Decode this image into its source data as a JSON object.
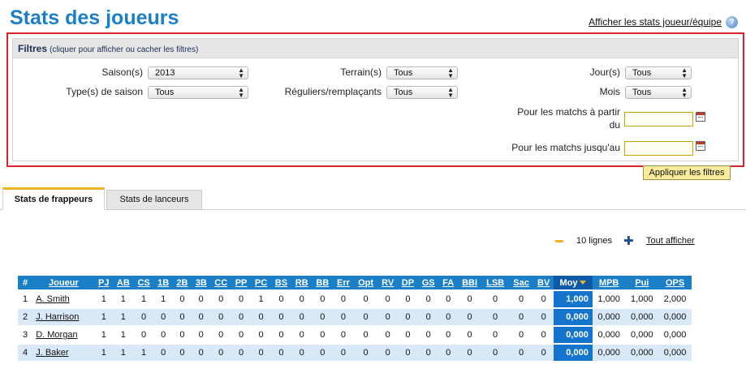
{
  "title": "Stats des joueurs",
  "top_link": "Afficher les stats joueur/équipe",
  "filters": {
    "header_title": "Filtres",
    "header_hint": "(cliquer pour afficher ou cacher les filtres)",
    "season_label": "Saison(s)",
    "season_value": "2013",
    "season_type_label": "Type(s) de saison",
    "season_type_value": "Tous",
    "field_label": "Terrain(s)",
    "field_value": "Tous",
    "regulars_label": "Réguliers/remplaçants",
    "regulars_value": "Tous",
    "day_label": "Jour(s)",
    "day_value": "Tous",
    "month_label": "Mois",
    "month_value": "Tous",
    "from_label": "Pour les matchs à partir du",
    "to_label": "Pour les matchs jusqu'au",
    "apply_label": "Appliquer les filtres"
  },
  "tabs": {
    "batting": "Stats de frappeurs",
    "pitching": "Stats de lanceurs"
  },
  "pager": {
    "rows_label": "10 lignes",
    "show_all_label": "Tout afficher"
  },
  "table": {
    "headers": [
      "#",
      "Joueur",
      "PJ",
      "AB",
      "CS",
      "1B",
      "2B",
      "3B",
      "CC",
      "PP",
      "PC",
      "BS",
      "RB",
      "BB",
      "Err",
      "Opt",
      "RV",
      "DP",
      "GS",
      "FA",
      "BBI",
      "LSB",
      "Sac",
      "BV",
      "Moy",
      "MPB",
      "Pui",
      "OPS"
    ],
    "rows": [
      [
        "1",
        "A. Smith",
        "1",
        "1",
        "1",
        "1",
        "0",
        "0",
        "0",
        "0",
        "1",
        "0",
        "0",
        "0",
        "0",
        "0",
        "0",
        "0",
        "0",
        "0",
        "0",
        "0",
        "0",
        "0",
        "1,000",
        "1,000",
        "1,000",
        "2,000"
      ],
      [
        "2",
        "J. Harrison",
        "1",
        "1",
        "0",
        "0",
        "0",
        "0",
        "0",
        "0",
        "0",
        "0",
        "0",
        "0",
        "0",
        "0",
        "0",
        "0",
        "0",
        "0",
        "0",
        "0",
        "0",
        "0",
        "0,000",
        "0,000",
        "0,000",
        "0,000"
      ],
      [
        "3",
        "D. Morgan",
        "1",
        "1",
        "0",
        "0",
        "0",
        "0",
        "0",
        "0",
        "0",
        "0",
        "0",
        "0",
        "0",
        "0",
        "0",
        "0",
        "0",
        "0",
        "0",
        "0",
        "0",
        "0",
        "0,000",
        "0,000",
        "0,000",
        "0,000"
      ],
      [
        "4",
        "J. Baker",
        "1",
        "1",
        "1",
        "0",
        "0",
        "0",
        "0",
        "0",
        "0",
        "0",
        "0",
        "0",
        "0",
        "0",
        "0",
        "0",
        "0",
        "0",
        "0",
        "0",
        "0",
        "0",
        "0,000",
        "0,000",
        "0,000",
        "0,000"
      ]
    ]
  },
  "colors": {
    "accent": "#1a7fc7",
    "highlight": "#f0b326",
    "filter_border": "#d8232a",
    "alt_row": "#d9e9f7"
  },
  "icons": {
    "help": "help-icon",
    "calendar": "calendar-icon",
    "collapse": "minus-icon",
    "expand": "plus-icon",
    "sort": "sort-desc-icon",
    "select_arrow": "select-arrows-icon"
  }
}
